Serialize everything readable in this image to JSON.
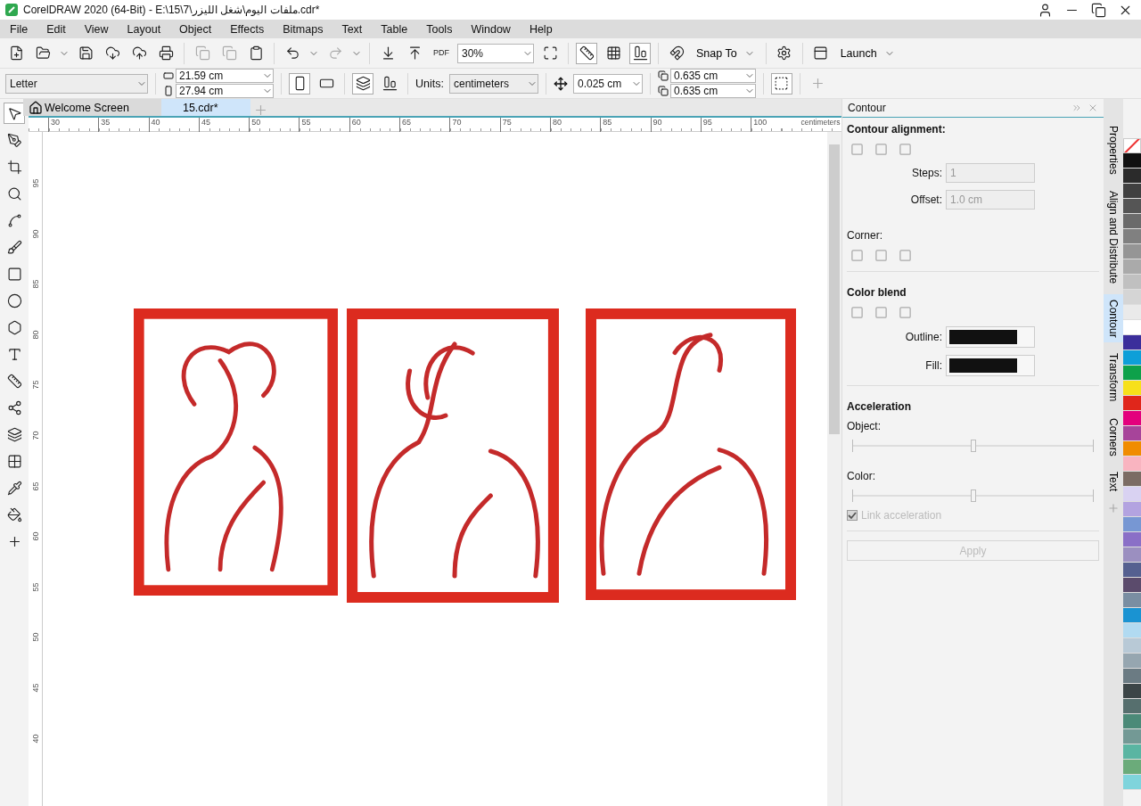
{
  "window": {
    "title": "CorelDRAW 2020 (64-Bit) - E:\\15\\7\\ملفات اليوم\\شغل الليزر.cdr*"
  },
  "menu": [
    "File",
    "Edit",
    "View",
    "Layout",
    "Object",
    "Effects",
    "Bitmaps",
    "Text",
    "Table",
    "Tools",
    "Window",
    "Help"
  ],
  "toolbar": {
    "pdf": "PDF",
    "zoom": "30%",
    "snap": "Snap To",
    "launch": "Launch"
  },
  "property_bar": {
    "page_size": "Letter",
    "width": "21.59 cm",
    "height": "27.94 cm",
    "units_label": "Units:",
    "units": "centimeters",
    "nudge": "0.025 cm",
    "dup_x": "0.635 cm",
    "dup_y": "0.635 cm"
  },
  "doc_tabs": [
    {
      "label": "Welcome Screen",
      "selected": false
    },
    {
      "label": "15.cdr*",
      "selected": true
    }
  ],
  "rulers": {
    "horizontal": [
      "30",
      "35",
      "40",
      "45",
      "50",
      "55",
      "60",
      "65",
      "70",
      "75",
      "80",
      "85",
      "90",
      "95",
      "100"
    ],
    "unit": "centimeters",
    "vertical": [
      "95",
      "90",
      "85",
      "80",
      "75",
      "70",
      "65",
      "60",
      "55",
      "50",
      "45",
      "40"
    ]
  },
  "docker": {
    "title": "Contour",
    "alignment_label": "Contour alignment:",
    "steps_label": "Steps:",
    "steps": "1",
    "offset_label": "Offset:",
    "offset": "1.0 cm",
    "corner_label": "Corner:",
    "blend_label": "Color blend",
    "outline_label": "Outline:",
    "fill_label": "Fill:",
    "acceleration_label": "Acceleration",
    "object_label": "Object:",
    "object_slider": {
      "level": 0.5
    },
    "color_label": "Color:",
    "color_slider": {
      "level": 0.5
    },
    "link": {
      "label": "Link acceleration",
      "checked": true,
      "disabled": true
    },
    "apply": {
      "label": "Apply",
      "disabled": true
    }
  },
  "side_tabs": [
    {
      "label": "Properties",
      "selected": false
    },
    {
      "label": "Align and Distribute",
      "selected": false
    },
    {
      "label": "Contour",
      "selected": true
    },
    {
      "label": "Transform",
      "selected": false
    },
    {
      "label": "Corners",
      "selected": false
    },
    {
      "label": "Text",
      "selected": false
    }
  ],
  "palette": [
    {
      "color": "#111111"
    },
    {
      "color": "#2b2b2b"
    },
    {
      "color": "#404040"
    },
    {
      "color": "#555555"
    },
    {
      "color": "#6b6b6b"
    },
    {
      "color": "#808080"
    },
    {
      "color": "#959595"
    },
    {
      "color": "#aaaaaa"
    },
    {
      "color": "#c0c0c0"
    },
    {
      "color": "#d5d5d5"
    },
    {
      "color": "#eaeaea"
    },
    {
      "color": "#ffffff"
    },
    {
      "color": "#3b2e9b"
    },
    {
      "color": "#0e9fd8"
    },
    {
      "color": "#0ea14a"
    },
    {
      "color": "#f7e01a"
    },
    {
      "color": "#e0261b"
    },
    {
      "color": "#e3007d"
    },
    {
      "color": "#a7449a"
    },
    {
      "color": "#f08c00"
    },
    {
      "color": "#f9b4c0"
    },
    {
      "color": "#7b6c64"
    },
    {
      "color": "#d9d2f2"
    },
    {
      "color": "#b3a3e0"
    },
    {
      "color": "#7797d3"
    },
    {
      "color": "#8a6fc7"
    },
    {
      "color": "#9b8fc0"
    },
    {
      "color": "#556090"
    },
    {
      "color": "#5b4b6c"
    },
    {
      "color": "#7a8ea2"
    },
    {
      "color": "#1a93d2"
    },
    {
      "color": "#b1daf1"
    },
    {
      "color": "#b8c9d6"
    },
    {
      "color": "#96a6b0"
    },
    {
      "color": "#6b7b83"
    },
    {
      "color": "#3c4547"
    },
    {
      "color": "#566f6e"
    },
    {
      "color": "#4b8a78"
    },
    {
      "color": "#739995"
    },
    {
      "color": "#5ab5a2"
    },
    {
      "color": "#6bab7a"
    },
    {
      "color": "#7fd4dc"
    }
  ]
}
